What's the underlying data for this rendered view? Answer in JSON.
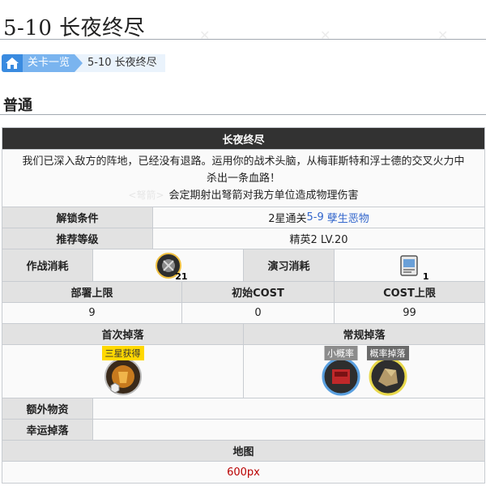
{
  "page": {
    "title": "5-10 长夜终尽"
  },
  "breadcrumb": {
    "home_icon": "home-icon",
    "parent": "关卡一览",
    "current": "5-10 长夜终尽"
  },
  "section": {
    "title": "普通"
  },
  "stage": {
    "name": "长夜终尽",
    "description_line1": "我们已深入敌方的阵地，已经没有退路。运用你的战术头脑，从梅菲斯特和浮士德的交叉火力中",
    "description_line2": "杀出一条血路！",
    "effect_tag": "<弩箭>",
    "effect_text": "会定期射出弩箭对我方单位造成物理伤害"
  },
  "unlock": {
    "label": "解锁条件",
    "prefix": "2星通关",
    "stage_code": "5-9",
    "stage_name": "孽生恶物"
  },
  "recommended": {
    "label": "推荐等级",
    "value": "精英2 LV.20"
  },
  "cost": {
    "battle_label": "作战消耗",
    "battle_value": "21",
    "practice_label": "演习消耗",
    "practice_value": "1"
  },
  "limits": {
    "deploy_label": "部署上限",
    "deploy_value": "9",
    "initial_cost_label": "初始COST",
    "initial_cost_value": "0",
    "cost_cap_label": "COST上限",
    "cost_cap_value": "99"
  },
  "drops": {
    "first_label": "首次掉落",
    "first_badge": "三星获得",
    "regular_label": "常规掉落",
    "regular_badge_1": "小概率",
    "regular_badge_2": "概率掉落"
  },
  "extra": {
    "label": "额外物资",
    "value": ""
  },
  "lucky": {
    "label": "幸运掉落",
    "value": ""
  },
  "map": {
    "label": "地图",
    "value": "600px"
  }
}
